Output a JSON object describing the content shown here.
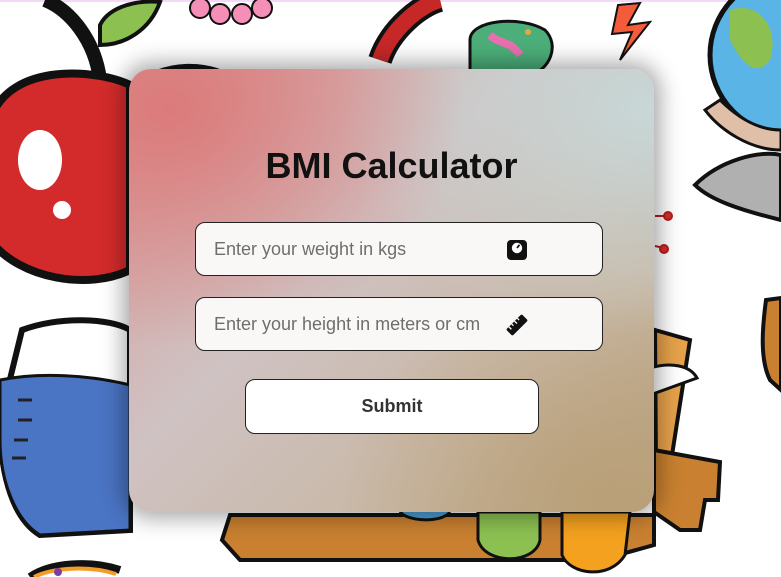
{
  "title": "BMI Calculator",
  "weight": {
    "placeholder": "Enter your weight in kgs",
    "value": "",
    "icon": "weight-scale-icon"
  },
  "height": {
    "placeholder": "Enter your height in meters or cm",
    "value": "",
    "icon": "ruler-icon"
  },
  "submit_label": "Submit",
  "background": {
    "icons": [
      "apple-icon",
      "flask-icon",
      "beaker-icon",
      "globe-icon",
      "lightning-icon",
      "flower-icon",
      "test-tube-icon",
      "microbe-icon"
    ]
  }
}
